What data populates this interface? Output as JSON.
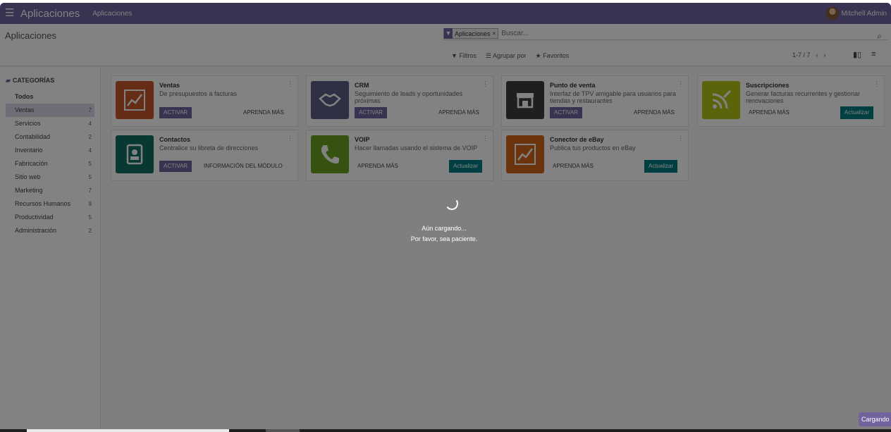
{
  "navbar": {
    "brand": "Aplicaciones",
    "menu_item": "Aplicaciones",
    "user": "Mitchell Admin",
    "color": "#71639e"
  },
  "control_panel": {
    "title": "Aplicaciones",
    "facet_label": "Aplicaciones",
    "search_placeholder": "Buscar...",
    "filters_label": "Filtros",
    "group_by_label": "Agrupar por",
    "favorites_label": "Favoritos",
    "pager": "1-7 / 7"
  },
  "sidebar": {
    "heading": "CATEGORÍAS",
    "items": [
      {
        "label": "Todos",
        "count": ""
      },
      {
        "label": "Ventas",
        "count": "7"
      },
      {
        "label": "Servicios",
        "count": "4"
      },
      {
        "label": "Contabilidad",
        "count": "2"
      },
      {
        "label": "Inventario",
        "count": "4"
      },
      {
        "label": "Fabricación",
        "count": "5"
      },
      {
        "label": "Sitio web",
        "count": "5"
      },
      {
        "label": "Marketing",
        "count": "7"
      },
      {
        "label": "Recursos Humanos",
        "count": "9"
      },
      {
        "label": "Productividad",
        "count": "5"
      },
      {
        "label": "Administración",
        "count": "2"
      }
    ]
  },
  "apps": [
    {
      "title": "Ventas",
      "desc": "De presupuestos a facturas",
      "icon": "trend-chart-icon",
      "color": "#c9582c",
      "primary": "ACTIVAR",
      "secondary": "APRENDA MÁS"
    },
    {
      "title": "CRM",
      "desc": "Seguimiento de leads y oportunidades próximas",
      "icon": "handshake-icon",
      "color": "#5f5f86",
      "primary": "ACTIVAR",
      "secondary": "APRENDA MÁS"
    },
    {
      "title": "Punto de venta",
      "desc": "Interfaz de TPV amigable para usuarios para tiendas y restaurantes",
      "icon": "shop-icon",
      "color": "#3d3d3d",
      "primary": "ACTIVAR",
      "secondary": "APRENDA MÁS"
    },
    {
      "title": "Suscripciones",
      "desc": "Generar facturas recurrentes y gestionar renovaciones",
      "icon": "rss-feed-icon",
      "color": "#b3c316",
      "primary": "Actualizar",
      "secondary": "APRENDA MÁS"
    },
    {
      "title": "Contactos",
      "desc": "Centralice su libreta de direcciones",
      "icon": "address-book-icon",
      "color": "#0f6f63",
      "primary": "ACTIVAR",
      "secondary": "INFORMACIÓN DEL MÓDULO"
    },
    {
      "title": "VOIP",
      "desc": "Hacer llamadas usando el sistema de VOIP",
      "icon": "phone-icon",
      "color": "#6aa121",
      "primary": "Actualizar",
      "secondary": "APRENDA MÁS"
    },
    {
      "title": "Conector de eBay",
      "desc": "Publica tus productos en eBay",
      "icon": "trend-chart-icon",
      "color": "#d26618",
      "primary": "Actualizar",
      "secondary": "APRENDA MÁS"
    }
  ],
  "loading": {
    "line1": "Aún cargando...",
    "line2": "Por favor, sea paciente.",
    "badge": "Cargando"
  }
}
